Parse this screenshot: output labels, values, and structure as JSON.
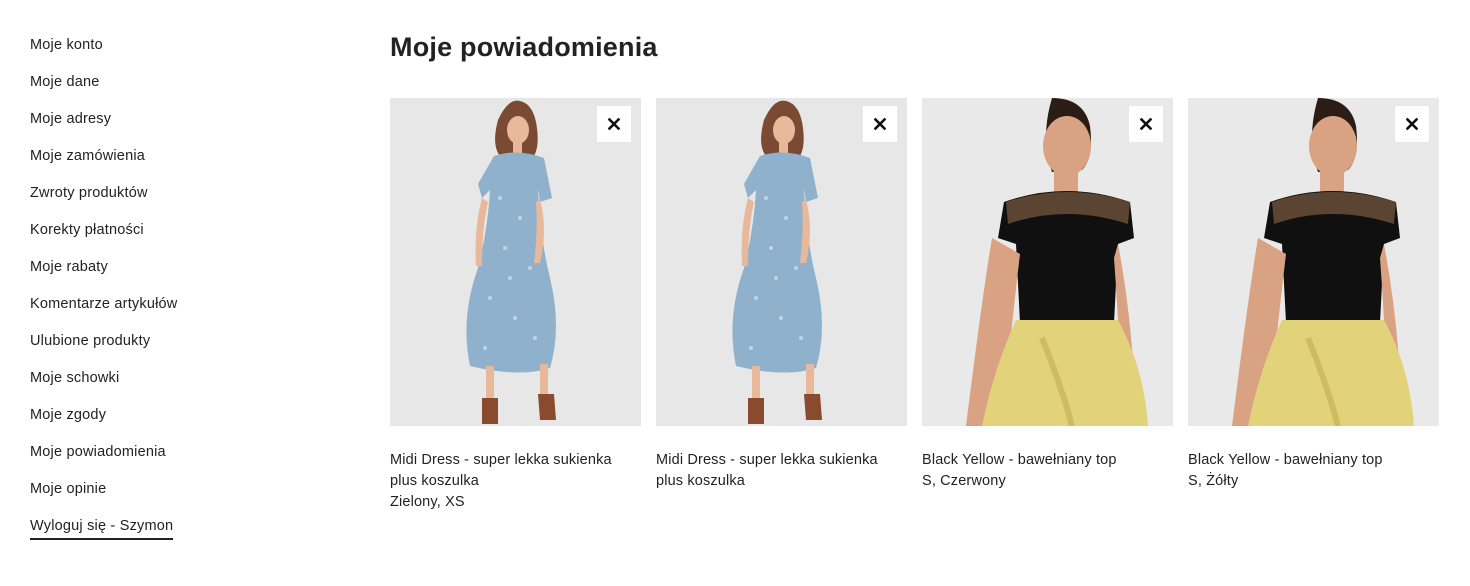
{
  "sidebar": {
    "items": [
      {
        "label": "Moje konto"
      },
      {
        "label": "Moje dane"
      },
      {
        "label": "Moje adresy"
      },
      {
        "label": "Moje zamówienia"
      },
      {
        "label": "Zwroty produktów"
      },
      {
        "label": "Korekty płatności"
      },
      {
        "label": "Moje rabaty"
      },
      {
        "label": "Komentarze artykułów"
      },
      {
        "label": "Ulubione produkty"
      },
      {
        "label": "Moje schowki"
      },
      {
        "label": "Moje zgody"
      },
      {
        "label": "Moje powiadomienia"
      },
      {
        "label": "Moje opinie"
      },
      {
        "label": "Wyloguj się - Szymon"
      }
    ]
  },
  "main": {
    "title": "Moje powiadomienia",
    "products": [
      {
        "name": "Midi Dress - super lekka sukienka plus koszulka",
        "variant": "Zielony, XS",
        "image": "dress"
      },
      {
        "name": "Midi Dress - super lekka sukienka plus koszulka",
        "variant": "",
        "image": "dress"
      },
      {
        "name": "Black Yellow - bawełniany top",
        "variant": "S, Czerwony",
        "image": "top"
      },
      {
        "name": "Black Yellow - bawełniany top",
        "variant": "S, Żółty",
        "image": "top"
      }
    ]
  },
  "icons": {
    "remove": "close-icon"
  }
}
